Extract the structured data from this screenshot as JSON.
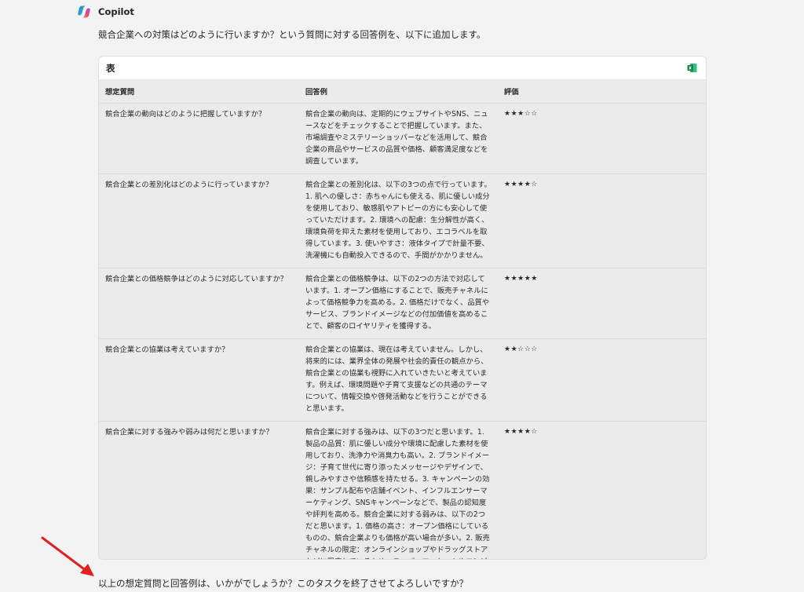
{
  "header": {
    "name": "Copilot",
    "logo_icon": "copilot-logo-icon"
  },
  "intro": "競合企業への対策はどのように行いますか？という質問に対する回答例を、以下に追加します。",
  "table_card": {
    "title": "表",
    "export_icon": "excel-icon",
    "columns": [
      "想定質問",
      "回答例",
      "評価"
    ],
    "rows": [
      {
        "question": "競合企業の動向はどのように把握していますか？",
        "answer": "競合企業の動向は、定期的にウェブサイトやSNS、ニュースなどをチェックすることで把握しています。また、市場調査やミステリーショッパーなどを活用して、競合企業の商品やサービスの品質や価格、顧客満足度などを調査しています。",
        "rating": "★★★☆☆"
      },
      {
        "question": "競合企業との差別化はどのように行っていますか？",
        "answer": "競合企業との差別化は、以下の3つの点で行っています。1. 肌への優しさ：赤ちゃんにも使える、肌に優しい成分を使用しており、敏感肌やアトピーの方にも安心して使っていただけます。2. 環境への配慮：生分解性が高く、環境負荷を抑えた素材を使用しており、エコラベルを取得しています。3. 使いやすさ：液体タイプで計量不要、洗濯機にも自動投入できるので、手間がかかりません。",
        "rating": "★★★★☆"
      },
      {
        "question": "競合企業との価格競争はどのように対応していますか？",
        "answer": "競合企業との価格競争は、以下の2つの方法で対応しています。1. オープン価格にすることで、販売チャネルによって価格競争力を高める。2. 価格だけでなく、品質やサービス、ブランドイメージなどの付加価値を高めることで、顧客のロイヤリティを獲得する。",
        "rating": "★★★★★"
      },
      {
        "question": "競合企業との協業は考えていますか？",
        "answer": "競合企業との協業は、現在は考えていません。しかし、将来的には、業界全体の発展や社会的責任の観点から、競合企業との協業も視野に入れていきたいと考えています。例えば、環境問題や子育て支援などの共通のテーマについて、情報交換や啓発活動などを行うことができると思います。",
        "rating": "★★☆☆☆"
      },
      {
        "question": "競合企業に対する強みや弱みは何だと思いますか？",
        "answer": "競合企業に対する強みは、以下の3つだと思います。1. 製品の品質：肌に優しい成分や環境に配慮した素材を使用しており、洗浄力や消臭力も高い。2. ブランドイメージ：子育て世代に寄り添ったメッセージやデザインで、親しみやすさや信頼感を持たせる。3. キャンペーンの効果：サンプル配布や店舗イベント、インフルエンサーマーケティング、SNSキャンペーンなどで、製品の認知度や評判を高める。競合企業に対する弱みは、以下の2つだと思います。1. 価格の高さ：オープン価格にしているものの、競合企業よりも価格が高い場合が多い。2. 販売チャネルの限定：オンラインショップやドラッグストアなどに限定しているため、スーパーマーケットやコンビニなどで購入できない。",
        "rating": "★★★★☆"
      }
    ]
  },
  "closing": "以上の想定質問と回答例は、いかがでしょうか？このタスクを終了させてよろしいですか？",
  "colors": {
    "background": "#f3f3f3",
    "card_body": "#ebebeb",
    "text": "#242424",
    "excel_green": "#107c41",
    "arrow_red": "#e02020"
  }
}
